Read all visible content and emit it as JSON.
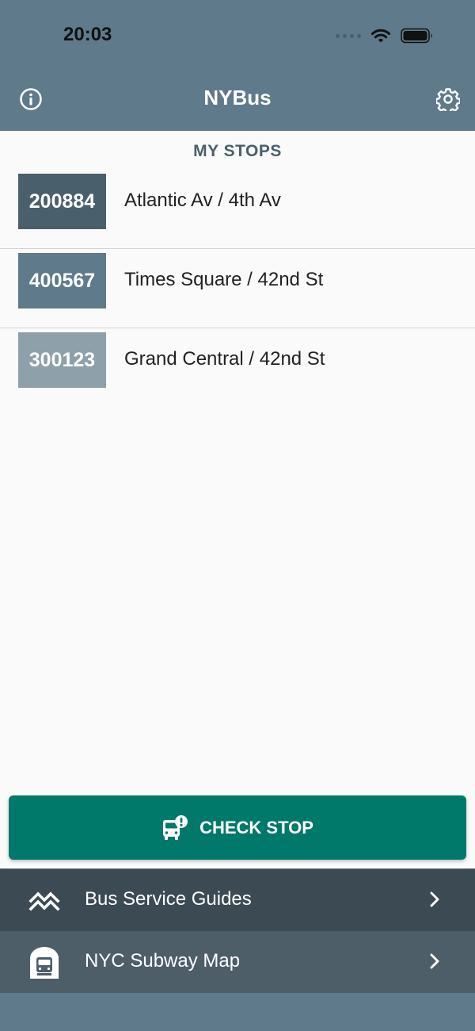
{
  "status": {
    "time": "20:03"
  },
  "nav": {
    "title": "NYBus"
  },
  "section": {
    "title": "MY STOPS"
  },
  "stops": [
    {
      "code": "200884",
      "name": "Atlantic Av / 4th Av",
      "color": "#4a5f6c"
    },
    {
      "code": "400567",
      "name": "Times Square / 42nd St",
      "color": "#5f7a8a"
    },
    {
      "code": "300123",
      "name": "Grand Central / 42nd St",
      "color": "#8ea0aa"
    }
  ],
  "check_button": {
    "label": "CHECK STOP"
  },
  "menu": [
    {
      "label": "Bus Service Guides",
      "icon": "route-icon"
    },
    {
      "label": "NYC Subway Map",
      "icon": "subway-icon"
    }
  ],
  "colors": {
    "primary": "#5f7a8a",
    "accent": "#00796b",
    "menu_dark": "#3c4a53",
    "menu_mid": "#4d5e69"
  }
}
